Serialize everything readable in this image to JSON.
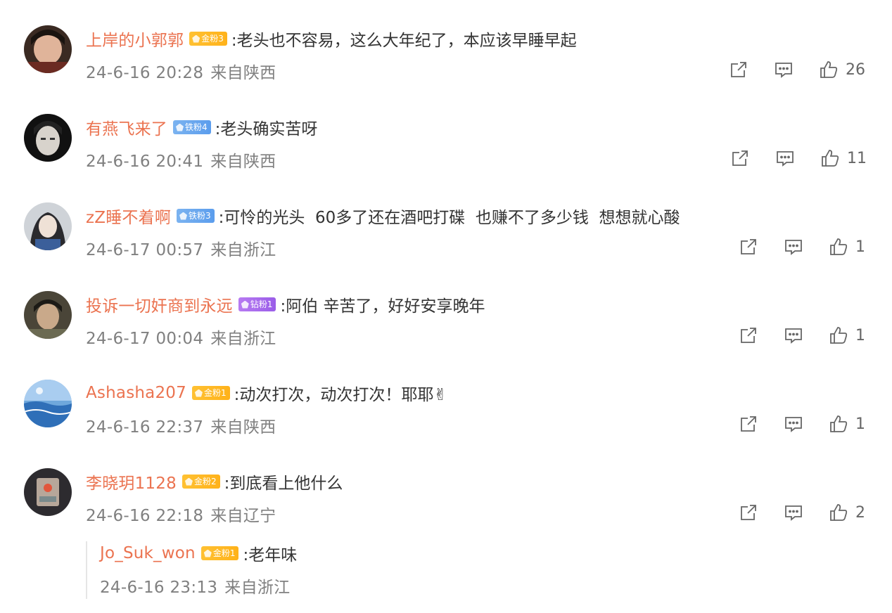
{
  "comments": [
    {
      "username": "上岸的小郭郭",
      "badge": {
        "type": "gold",
        "label": "金粉3"
      },
      "text": ":老头也不容易，这么大年纪了，本应该早睡早起",
      "date": "24-6-16 20:28",
      "location": "来自陕西",
      "likes": "26"
    },
    {
      "username": "有燕飞来了",
      "badge": {
        "type": "iron",
        "label": "铁粉4"
      },
      "text": ":老头确实苦呀",
      "date": "24-6-16 20:41",
      "location": "来自陕西",
      "likes": "11"
    },
    {
      "username": "zZ睡不着啊",
      "badge": {
        "type": "iron",
        "label": "铁粉3"
      },
      "text": ":可怜的光头  60多了还在酒吧打碟  也赚不了多少钱  想想就心酸",
      "date": "24-6-17 00:57",
      "location": "来自浙江",
      "likes": "1"
    },
    {
      "username": "投诉一切奸商到永远",
      "badge": {
        "type": "diamond",
        "label": "钻粉1"
      },
      "text": ":阿伯 辛苦了，好好安享晚年",
      "date": "24-6-17 00:04",
      "location": "来自浙江",
      "likes": "1"
    },
    {
      "username": "Ashasha207",
      "badge": {
        "type": "gold",
        "label": "金粉1"
      },
      "text": ":动次打次，动次打次！耶耶✌",
      "date": "24-6-16 22:37",
      "location": "来自陕西",
      "likes": "1"
    },
    {
      "username": "李晓玥1128",
      "badge": {
        "type": "gold",
        "label": "金粉2"
      },
      "text": ":到底看上他什么",
      "date": "24-6-16 22:18",
      "location": "来自辽宁",
      "likes": "2"
    }
  ],
  "reply": {
    "username": "Jo_Suk_won",
    "badge": {
      "type": "gold",
      "label": "金粉1"
    },
    "text": ":老年味",
    "date": "24-6-16 23:13",
    "location": "来自浙江"
  },
  "icons": {
    "share": "share-icon",
    "comment": "comment-icon",
    "like": "thumbs-up-icon"
  },
  "colors": {
    "username": "#eb7350",
    "meta": "#808080",
    "gold_badge": "#ffb21a",
    "iron_badge": "#5b9ded",
    "diamond_badge": "#9a5de8"
  }
}
